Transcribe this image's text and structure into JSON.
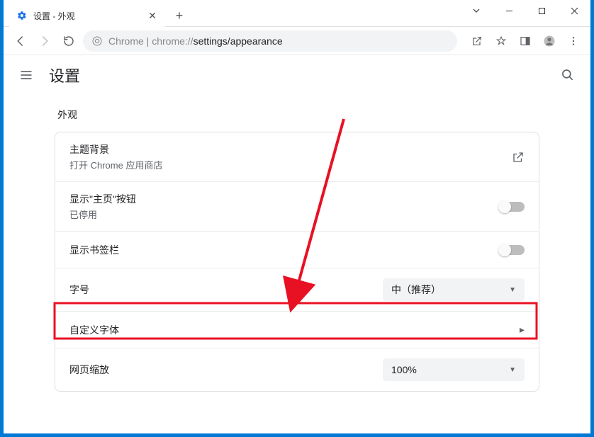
{
  "tab": {
    "title": "设置 - 外观"
  },
  "address": {
    "prefix": "Chrome | chrome://",
    "strong": "settings/appearance"
  },
  "header": {
    "title": "设置"
  },
  "section": {
    "title": "外观"
  },
  "rows": {
    "theme": {
      "label": "主题背景",
      "sub": "打开 Chrome 应用商店"
    },
    "home": {
      "label": "显示\"主页\"按钮",
      "sub": "已停用"
    },
    "bookmarks": {
      "label": "显示书签栏"
    },
    "fontSize": {
      "label": "字号",
      "value": "中（推荐）"
    },
    "customFont": {
      "label": "自定义字体"
    },
    "zoom": {
      "label": "网页缩放",
      "value": "100%"
    }
  }
}
